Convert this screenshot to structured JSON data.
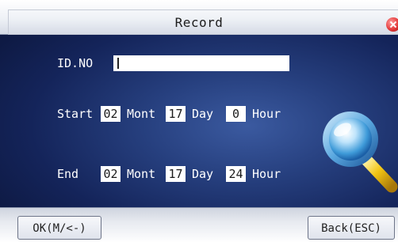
{
  "window": {
    "title": "Record",
    "close_icon": "close-icon"
  },
  "form": {
    "id_label": "ID.NO",
    "id_value": "",
    "start": {
      "label": "Start",
      "month": "02",
      "month_unit": "Mont",
      "day": "17",
      "day_unit": "Day",
      "hour": "0",
      "hour_unit": "Hour"
    },
    "end": {
      "label": "End",
      "month": "02",
      "month_unit": "Mont",
      "day": "17",
      "day_unit": "Day",
      "hour": "24",
      "hour_unit": "Hour"
    }
  },
  "decoration": {
    "icon": "search-icon"
  },
  "buttons": {
    "ok_label": "OK(M/<-)",
    "back_label": "Back(ESC)"
  },
  "colors": {
    "background": "#1c2d66",
    "field": "#ffffff",
    "label_text": "#ffffff",
    "close": "#e33a3a"
  }
}
